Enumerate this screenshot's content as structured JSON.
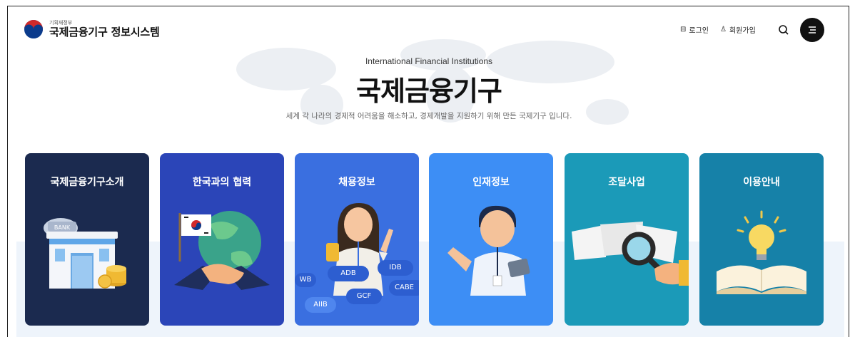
{
  "header": {
    "ministry": "기획재정부",
    "site_title": "국제금융기구 정보시스템",
    "login_label": "로그인",
    "signup_label": "회원가입"
  },
  "hero": {
    "subtitle": "International Financial Institutions",
    "title": "국제금융기구",
    "description": "세계 각 나라의 경제적 어려움을 해소하고, 경제개발을 지원하기 위해 만든 국제기구 입니다."
  },
  "cards": [
    {
      "title": "국제금융기구소개",
      "color": "#1b2a4f",
      "icon": "bank-building-icon"
    },
    {
      "title": "한국과의 협력",
      "color": "#2b45b8",
      "icon": "handshake-globe-icon"
    },
    {
      "title": "채용정보",
      "color": "#3a6fe0",
      "icon": "woman-pointing-icon"
    },
    {
      "title": "인재정보",
      "color": "#3d8ef5",
      "icon": "man-tablet-icon"
    },
    {
      "title": "조달사업",
      "color": "#1b9ab8",
      "icon": "magnifier-documents-icon"
    },
    {
      "title": "이용안내",
      "color": "#1681a8",
      "icon": "lightbulb-book-icon"
    }
  ],
  "tags": [
    "WB",
    "ADB",
    "IDB",
    "AIIB",
    "GCF",
    "CABE"
  ],
  "bank_sign": "BANK"
}
